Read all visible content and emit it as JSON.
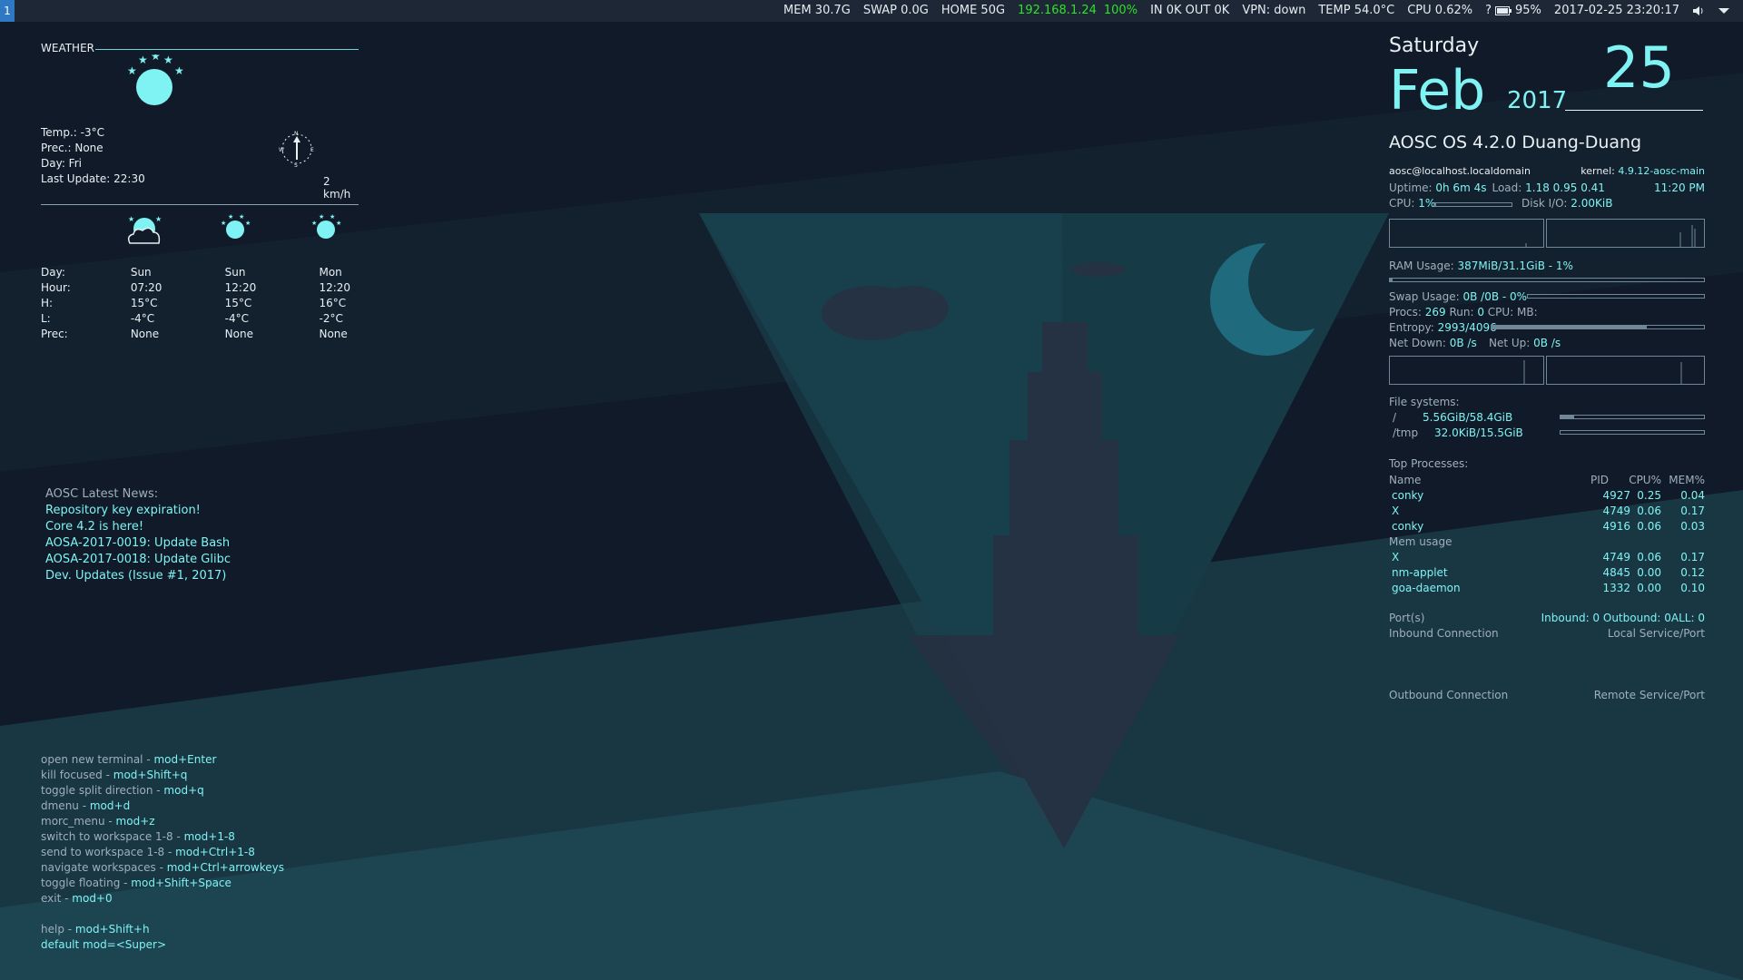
{
  "topbar": {
    "workspace": "1",
    "mem": "MEM 30.7G",
    "swap": "SWAP 0.0G",
    "home": "HOME 50G",
    "ip": "192.168.1.24",
    "wifi_pct": "100%",
    "net": "IN 0K OUT 0K",
    "vpn": "VPN: down",
    "temp": "TEMP 54.0°C",
    "cpu": "CPU 0.62%",
    "battery_symbol": "?",
    "battery": "95%",
    "datetime": "2017-02-25 23:20:17",
    "volume_icon": "speaker-icon",
    "tray_icon": "chevron-down-icon"
  },
  "weather": {
    "title": "WEATHER",
    "temp": "Temp.: -3°C",
    "prec": "Prec.: None",
    "day": "Day: Fri",
    "last_update": "Last Update: 22:30",
    "wind": "2 km/h",
    "compass": {
      "n": "N",
      "s": "S",
      "e": "E",
      "w": "W"
    },
    "forecast_labels": {
      "day": "Day:",
      "hour": "Hour:",
      "high": "H:",
      "low": "L:",
      "prec": "Prec:"
    },
    "forecast": [
      {
        "day": "Sun",
        "hour": "07:20",
        "high": "15°C",
        "low": "-4°C",
        "prec": "None",
        "icon": "cloud-moon-icon"
      },
      {
        "day": "Sun",
        "hour": "12:20",
        "high": "15°C",
        "low": "-4°C",
        "prec": "None",
        "icon": "moon-stars-icon"
      },
      {
        "day": "Mon",
        "hour": "12:20",
        "high": "16°C",
        "low": "-2°C",
        "prec": "None",
        "icon": "moon-stars-icon"
      }
    ]
  },
  "news": {
    "title": "AOSC Latest News:",
    "items": [
      "Repository key expiration!",
      "Core 4.2 is here!",
      "AOSA-2017-0019: Update Bash",
      "AOSA-2017-0018: Update Glibc",
      "Dev. Updates (Issue #1, 2017)"
    ]
  },
  "shortcuts": {
    "items": [
      {
        "label": "open new terminal - ",
        "key": "mod+Enter"
      },
      {
        "label": "kill focused - ",
        "key": "mod+Shift+q"
      },
      {
        "label": "toggle split direction - ",
        "key": "mod+q"
      },
      {
        "label": "dmenu - ",
        "key": "mod+d"
      },
      {
        "label": "morc_menu - ",
        "key": "mod+z"
      },
      {
        "label": "switch to workspace 1-8 - ",
        "key": "mod+1-8"
      },
      {
        "label": "send to workspace 1-8 - ",
        "key": "mod+Ctrl+1-8"
      },
      {
        "label": "navigate workspaces - ",
        "key": "mod+Ctrl+arrowkeys"
      },
      {
        "label": "toggle floating - ",
        "key": "mod+Shift+Space"
      },
      {
        "label": "exit - ",
        "key": "mod+0"
      }
    ],
    "help_label": "help - ",
    "help_key": "mod+Shift+h",
    "default_mod": "default mod=<Super>"
  },
  "clock": {
    "weekday": "Saturday",
    "month": "Feb",
    "year": "2017",
    "day": "25"
  },
  "sysinfo": {
    "os": "AOSC OS 4.2.0 Duang-Duang",
    "host": "aosc@localhost.localdomain",
    "kernel_label": "kernel: ",
    "kernel": "4.9.12-aosc-main",
    "uptime_label": "Uptime: ",
    "uptime": "0h 6m 4s",
    "load_label": "Load: ",
    "load": "1.18 0.95 0.41",
    "time": "11:20 PM",
    "cpu_label": "CPU: ",
    "cpu": "1%",
    "cpu_fraction": 0.01,
    "disk_label": "Disk I/O: ",
    "disk": "2.00KiB",
    "ram_label": "RAM Usage: ",
    "ram": "387MiB/31.1GiB - 1%",
    "ram_fraction": 0.01,
    "swap_label": "Swap Usage: ",
    "swap": "0B  /0B   - 0%",
    "swap_fraction": 0.0,
    "procs_label": "Procs: ",
    "procs": "269",
    "run_label": " Run: ",
    "run": "0",
    "cpu_mb": " CPU:  MB:",
    "entropy_label": "Entropy: ",
    "entropy": "2993/4096",
    "entropy_fraction": 0.73,
    "netdown_label": "Net Down: ",
    "netdown": "0B  /s",
    "netup_label": "Net Up: ",
    "netup": "0B  /s",
    "fs_title": "File systems:",
    "fs": [
      {
        "mount": "/",
        "usage": "5.56GiB/58.4GiB",
        "fraction": 0.095
      },
      {
        "mount": "/tmp",
        "usage": "32.0KiB/15.5GiB",
        "fraction": 0.0
      }
    ],
    "top_title": "Top Processes:",
    "top_headers": {
      "name": "Name",
      "pid": "PID",
      "cpu": "CPU%",
      "mem": "MEM%"
    },
    "top_cpu": [
      {
        "name": "conky",
        "pid": "4927",
        "cpu": "0.25",
        "mem": "0.04"
      },
      {
        "name": "X",
        "pid": "4749",
        "cpu": "0.06",
        "mem": "0.17"
      },
      {
        "name": "conky",
        "pid": "4916",
        "cpu": "0.06",
        "mem": "0.03"
      }
    ],
    "mem_title": "Mem usage",
    "top_mem": [
      {
        "name": "X",
        "pid": "4749",
        "cpu": "0.06",
        "mem": "0.17"
      },
      {
        "name": "nm-applet",
        "pid": "4845",
        "cpu": "0.00",
        "mem": "0.12"
      },
      {
        "name": "goa-daemon",
        "pid": "1332",
        "cpu": "0.00",
        "mem": "0.10"
      }
    ],
    "ports_label": "Port(s)",
    "ports_value": "Inbound: 0  Outbound: 0ALL: 0",
    "inbound_conn": "Inbound Connection",
    "local_service": "Local Service/Port",
    "outbound_conn": "Outbound Connection",
    "remote_service": "Remote Service/Port"
  },
  "colors": {
    "accent": "#7ff3f3",
    "bar_bg": "#1d2735",
    "workspace": "#2f78c4",
    "green": "#2fe12a"
  }
}
